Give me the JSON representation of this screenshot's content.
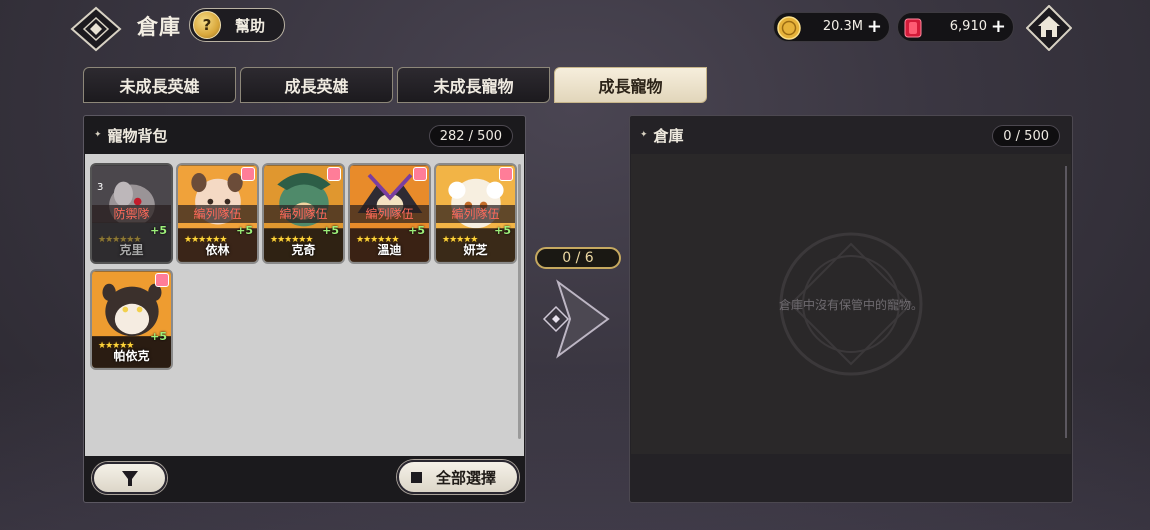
{
  "header": {
    "title": "倉庫",
    "help_label": "幫助",
    "help_icon_text": "?"
  },
  "currency": {
    "gold_value": "20.3M",
    "gem_value": "6,910",
    "plus": "+"
  },
  "tabs": [
    {
      "label": "未成長英雄",
      "active": false
    },
    {
      "label": "成長英雄",
      "active": false
    },
    {
      "label": "未成長寵物",
      "active": false
    },
    {
      "label": "成長寵物",
      "active": true
    }
  ],
  "left_panel": {
    "star": "✦",
    "title": "寵物背包",
    "count": "282 / 500",
    "pets": [
      {
        "name": "克里",
        "badge": "防禦隊",
        "plus": "+5",
        "level": "3",
        "stars": "★★★★★★"
      },
      {
        "name": "依林",
        "badge": "編列隊伍",
        "plus": "+5",
        "stars": "★★★★★★"
      },
      {
        "name": "克奇",
        "badge": "編列隊伍",
        "plus": "+5",
        "stars": "★★★★★★"
      },
      {
        "name": "溫迪",
        "badge": "編列隊伍",
        "plus": "+5",
        "stars": "★★★★★★"
      },
      {
        "name": "妍芝",
        "badge": "編列隊伍",
        "plus": "+5",
        "stars": "★★★★★"
      },
      {
        "name": "帕依克",
        "badge": "",
        "plus": "+5",
        "stars": "★★★★★"
      }
    ],
    "select_all_label": "全部選擇"
  },
  "transfer": {
    "count": "0 / 6"
  },
  "right_panel": {
    "star": "✦",
    "title": "倉庫",
    "count": "0 / 500",
    "empty_text": "倉庫中沒有保管中的寵物。"
  }
}
